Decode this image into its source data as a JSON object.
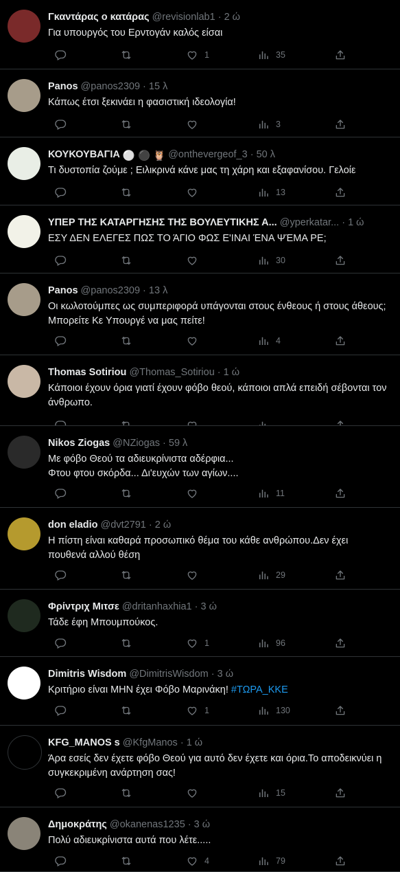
{
  "tweets": [
    {
      "name": "Γκαντάρας ο κατάρας",
      "handle": "@revisionlab1",
      "time": "2 ώ",
      "text": "Για υπουργός του Ερντογάν καλός είσαι",
      "tag": "",
      "likes": "1",
      "views": "35",
      "avatar_color": "#7a2a2a",
      "badges": []
    },
    {
      "name": "Panos",
      "handle": "@panos2309",
      "time": "15 λ",
      "text": "Κάπως έτσι ξεκινάει η φασιστική ιδεολογία!",
      "tag": "",
      "likes": "",
      "views": "3",
      "avatar_color": "#a79c8a",
      "badges": []
    },
    {
      "name": "ΚΟΥΚΟΥΒΑΓΙΑ",
      "handle": "@onthevergeof_3",
      "time": "50 λ",
      "text": "Τι δυστοπία ζούμε ; Ειλικρινά κάνε μας τη χάρη και εξαφανίσου. Γελοίε",
      "tag": "",
      "likes": "",
      "views": "13",
      "avatar_color": "#e9eee6",
      "badges": [
        "⚪",
        "⚫",
        "🦉"
      ]
    },
    {
      "name": "ΥΠΕΡ ΤΗΣ ΚΑΤΑΡΓΗΣΗΣ ΤΗΣ ΒΟΥΛΕΥΤΙΚΗΣ Α...",
      "handle": "@yperkatar...",
      "time": "1 ώ",
      "text": "ΕΣΥ ΔΕΝ ΕΛΕΓΕΣ ΠΩΣ ΤΟ ΆΓΙΟ ΦΩΣ Ε'ΙΝΑΙ ΈΝΑ ΨΈΜΑ ΡΕ;",
      "tag": "",
      "likes": "",
      "views": "30",
      "avatar_color": "#f2f2e8",
      "badges": []
    },
    {
      "name": "Panos",
      "handle": "@panos2309",
      "time": "13 λ",
      "text": "Οι κωλοτούμπες ως συμπεριφορά υπάγονται στους ένθεους ή στους άθεους;  Μπορείτε Κε Υπουργέ να μας πείτε!",
      "tag": "",
      "likes": "",
      "views": "4",
      "avatar_color": "#a79c8a",
      "badges": []
    },
    {
      "name": "Thomas Sotiriou",
      "handle": "@Thomas_Sotiriou",
      "time": "1 ώ",
      "text": "Κάποιοι έχουν όρια γιατί έχουν φόβο θεού, κάποιοι απλά επειδή σέβονται τον άνθρωπο.",
      "tag": "",
      "likes": "",
      "views": "",
      "avatar_color": "#c9b8a6",
      "badges": []
    },
    {
      "name": "Nikos Ziogas",
      "handle": "@NZiogas",
      "time": "59 λ",
      "text": "Με φόβο Θεού τα αδιευκρίνιστα αδέρφια...\nΦτου φτου σκόρδα... Δι'ευχών των αγίων....",
      "tag": "",
      "likes": "",
      "views": "11",
      "avatar_color": "#2a2a2a",
      "badges": []
    },
    {
      "name": "don eladio",
      "handle": "@dvt2791",
      "time": "2 ώ",
      "text": "Η πίστη είναι καθαρά προσωπικό θέμα του κάθε ανθρώπου.Δεν έχει πουθενά αλλού θέση",
      "tag": "",
      "likes": "",
      "views": "29",
      "avatar_color": "#b59a2e",
      "badges": []
    },
    {
      "name": "Φρίντριχ Μιτσε",
      "handle": "@dritanhaxhia1",
      "time": "3 ώ",
      "text": "Τάδε έφη  Μπουμπούκος.",
      "tag": "",
      "likes": "1",
      "views": "96",
      "avatar_color": "#1f2a1f",
      "badges": []
    },
    {
      "name": "Dimitris Wisdom",
      "handle": "@DimitrisWisdom",
      "time": "3 ώ",
      "text": "Κριτήριο είναι ΜΗΝ έχει Φόβο Μαρινάκη! ",
      "tag": "#ΤΩΡΑ_ΚΚΕ",
      "likes": "1",
      "views": "130",
      "avatar_color": "#ffffff",
      "badges": []
    },
    {
      "name": "KFG_MANOS s",
      "handle": "@KfgManos",
      "time": "1 ώ",
      "text": "Άρα εσείς δεν έχετε φόβο Θεού για αυτό δεν έχετε και όρια.Το αποδεικνύει η συγκεκριμένη ανάρτηση σας!",
      "tag": "",
      "likes": "",
      "views": "15",
      "avatar_color": "#000000",
      "badges": []
    },
    {
      "name": "Δημοκράτης",
      "handle": "@okanenas1235",
      "time": "3 ώ",
      "text": "Πολύ αδιευκρίνιστα αυτά που λέτε.....",
      "tag": "",
      "likes": "4",
      "views": "79",
      "avatar_color": "#8a8478",
      "badges": []
    }
  ]
}
